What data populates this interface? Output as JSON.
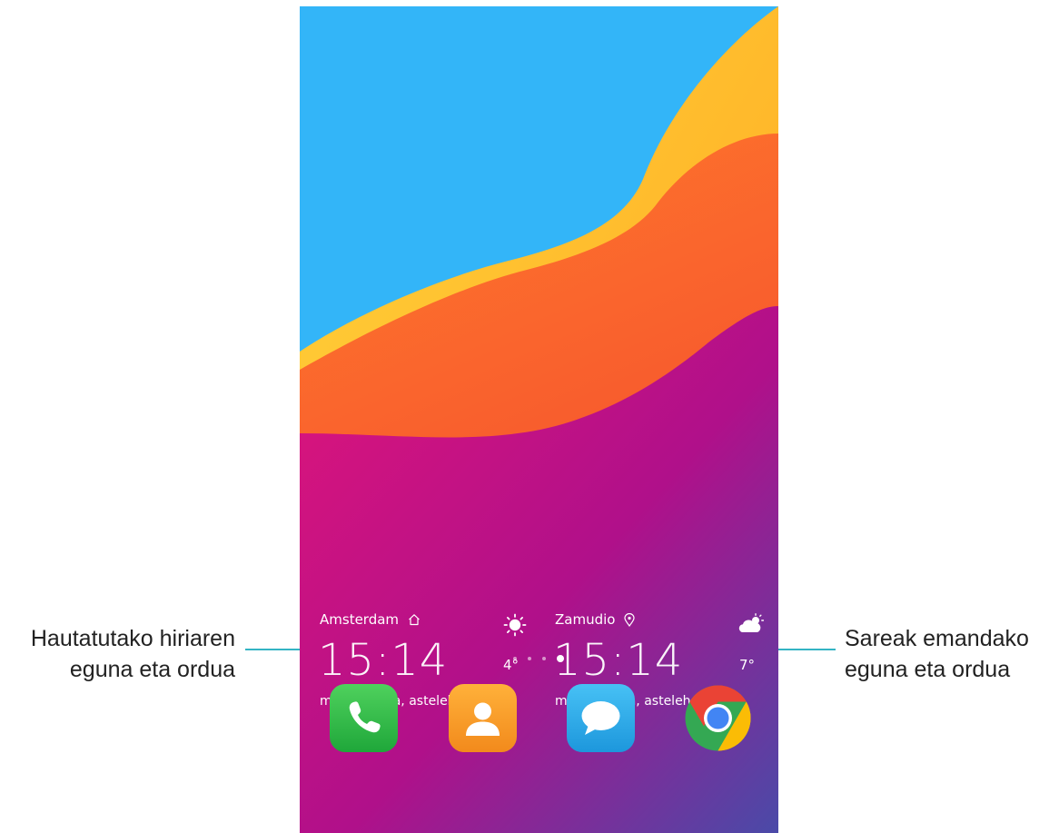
{
  "callouts": {
    "left": {
      "line1": "Hautatutako hiriaren",
      "line2": "eguna eta ordua"
    },
    "right": {
      "line1": "Sareak emandako",
      "line2": "eguna eta ordua"
    },
    "color": "#34b4c4"
  },
  "home_screen": {
    "clock_left": {
      "city": "Amsterdam",
      "city_icon": "home-icon",
      "time": "15:14",
      "date": "martxoa 19a, astelehena",
      "weather_icon": "sunny-icon",
      "temperature": "4°"
    },
    "clock_right": {
      "city": "Zamudio",
      "city_icon": "location-pin-icon",
      "time": "15:14",
      "date": "martxoa 19a, astelehena",
      "weather_icon": "partly-cloudy-icon",
      "temperature": "7°"
    },
    "page_indicator": {
      "pages": 4,
      "active_page": 4
    },
    "dock": [
      {
        "app": "phone",
        "icon": "phone-icon",
        "color": "#2fb84a"
      },
      {
        "app": "contacts",
        "icon": "contacts-icon",
        "color": "#f5a623"
      },
      {
        "app": "messages",
        "icon": "messages-icon",
        "color": "#2fa7e6"
      },
      {
        "app": "chrome",
        "icon": "chrome-icon",
        "color": "#4285f4"
      }
    ]
  },
  "colors": {
    "sky": "#33b5f8",
    "yellow": "#ffc02a",
    "orange": "#ff6a2a",
    "magenta": "#c8107a",
    "purple": "#5a3aa8"
  }
}
